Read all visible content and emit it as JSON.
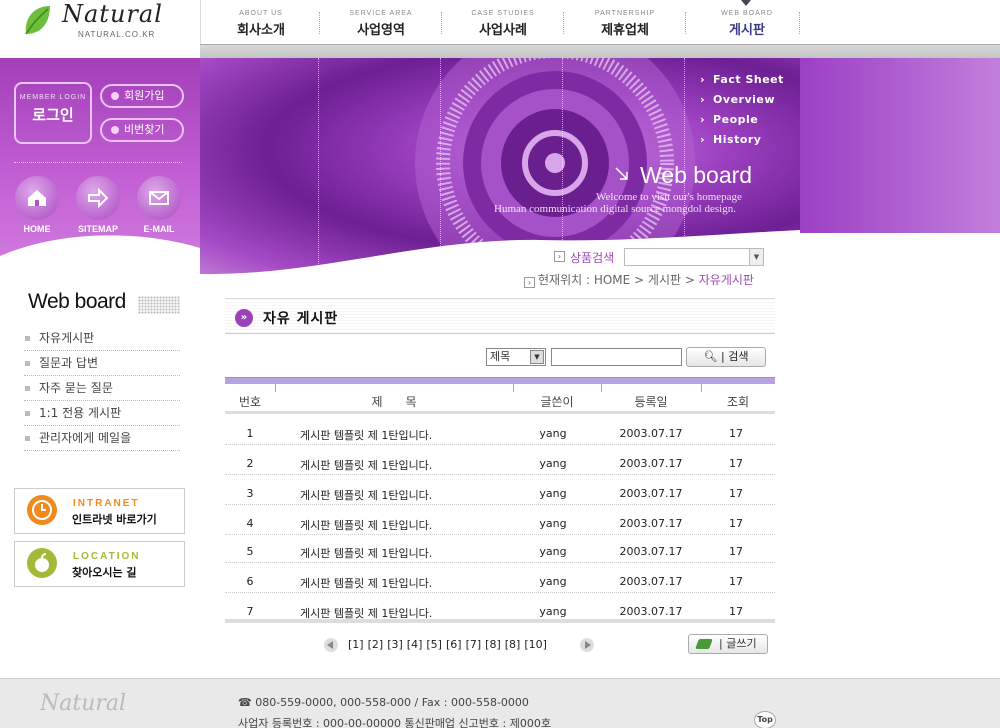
{
  "logo": {
    "word": "Natural",
    "url": "NATURAL.CO.KR"
  },
  "topnav": [
    {
      "en": "ABOUT US",
      "ko": "회사소개"
    },
    {
      "en": "SERVICE AREA",
      "ko": "사업영역"
    },
    {
      "en": "CASE STUDIES",
      "ko": "사업사례"
    },
    {
      "en": "PARTNERSHIP",
      "ko": "제휴업체"
    },
    {
      "en": "WEB BOARD",
      "ko": "게시판"
    }
  ],
  "sidebar": {
    "login_en": "MEMBER LOGIN",
    "login_ko": "로그인",
    "join": "회원가입",
    "find_pw": "비번찾기",
    "quick": [
      {
        "label": "HOME",
        "icon": "home-icon"
      },
      {
        "label": "SITEMAP",
        "icon": "arrow-right-icon"
      },
      {
        "label": "E-MAIL",
        "icon": "mail-icon"
      }
    ],
    "title": "Web board",
    "menu": [
      "자유게시판",
      "질문과 답변",
      "자주 묻는 질문",
      "1:1 전용 게시판",
      "관리자에게 메일을"
    ],
    "banners": [
      {
        "en": "INTRANET",
        "ko": "인트라넷 바로가기",
        "color": "#f08a1c"
      },
      {
        "en": "LOCATION",
        "ko": "찾아오시는 길",
        "color": "#a6b83a"
      }
    ]
  },
  "hero": {
    "links": [
      "Fact Sheet",
      "Overview",
      "People",
      "History"
    ],
    "title": "Web board",
    "sub1": "Welcome to visit our's homepage",
    "sub2": "Human communication digital source mongdol design."
  },
  "product_search": {
    "label": "상품검색",
    "value": ""
  },
  "breadcrumb": {
    "prefix": "현재위치 : HOME > 게시판 > ",
    "current": "자유게시판"
  },
  "board": {
    "title": "자유 게시판",
    "search_option": "제목",
    "search_value": "",
    "search_button": "검색",
    "columns": [
      "번호",
      "제      목",
      "글쓴이",
      "등록일",
      "조회"
    ],
    "rows": [
      {
        "no": "1",
        "title": "게시판 템플릿 제 1탄입니다.",
        "author": "yang",
        "date": "2003.07.17",
        "views": "17"
      },
      {
        "no": "2",
        "title": "게시판 템플릿 제 1탄입니다.",
        "author": "yang",
        "date": "2003.07.17",
        "views": "17"
      },
      {
        "no": "3",
        "title": "게시판 템플릿 제 1탄입니다.",
        "author": "yang",
        "date": "2003.07.17",
        "views": "17"
      },
      {
        "no": "4",
        "title": "게시판 템플릿 제 1탄입니다.",
        "author": "yang",
        "date": "2003.07.17",
        "views": "17"
      },
      {
        "no": "5",
        "title": "게시판 템플릿 제 1탄입니다.",
        "author": "yang",
        "date": "2003.07.17",
        "views": "17"
      },
      {
        "no": "6",
        "title": "게시판 템플릿 제 1탄입니다.",
        "author": "yang",
        "date": "2003.07.17",
        "views": "17"
      },
      {
        "no": "7",
        "title": "게시판 템플릿 제 1탄입니다.",
        "author": "yang",
        "date": "2003.07.17",
        "views": "17"
      }
    ],
    "pages": [
      "[1]",
      "[2]",
      "[3]",
      "[4]",
      "[5]",
      "[6]",
      "[7]",
      "[8]",
      "[8]",
      "[10]"
    ],
    "write_button": "글쓰기"
  },
  "footer": {
    "logo": "Natural",
    "line1": "☎ 080-559-0000, 000-558-000 / Fax : 000-558-0000",
    "line2": "사업자 등록번호 : 000-00-00000   통신판매업 신고번호 : 제000호",
    "top": "Top"
  },
  "colors": {
    "accent": "#a04ab8",
    "purple": "#9b42b9",
    "table_top": "#b7a3e2"
  }
}
